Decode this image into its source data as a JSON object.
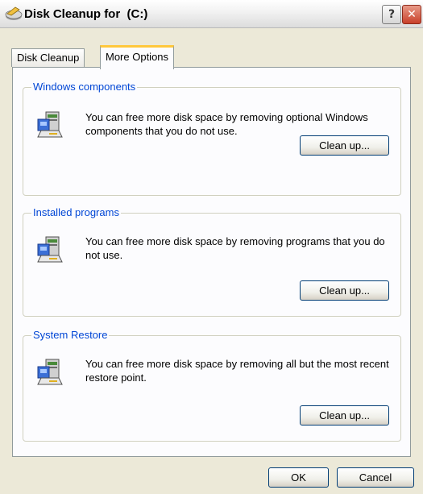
{
  "window": {
    "title": "Disk Cleanup for  (C:)",
    "title_icon": "disk-cleanup-icon",
    "help_label": "?",
    "close_label": "✕"
  },
  "tabs": [
    {
      "label": "Disk Cleanup",
      "selected": false
    },
    {
      "label": "More Options",
      "selected": true
    }
  ],
  "groups": [
    {
      "title": "Windows components",
      "description": "You can free more disk space by removing optional Windows components that you do not use.",
      "button_label": "Clean up...",
      "icon": "setup-program-icon"
    },
    {
      "title": "Installed programs",
      "description": "You can free more disk space by removing programs that you do not use.",
      "button_label": "Clean up...",
      "icon": "setup-program-icon"
    },
    {
      "title": "System Restore",
      "description": "You can free more disk space by removing all but the most recent restore point.",
      "button_label": "Clean up...",
      "icon": "setup-program-icon"
    }
  ],
  "buttons": {
    "ok_label": "OK",
    "cancel_label": "Cancel"
  },
  "colors": {
    "dialog_background": "#ece9d8",
    "group_title": "#0046d5",
    "active_tab_accent": "#ffc83c"
  }
}
